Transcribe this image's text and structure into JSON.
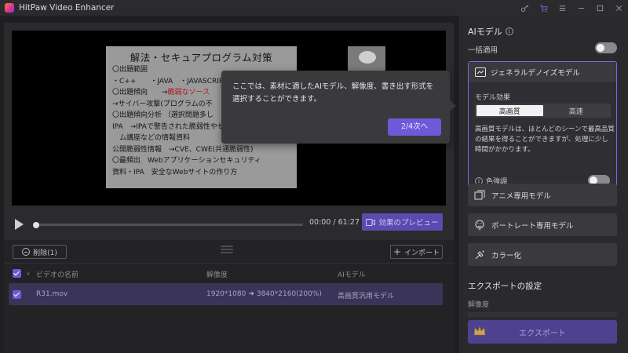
{
  "window": {
    "title": "HitPaw Video Enhancer",
    "icons": [
      "key-icon",
      "cart-icon",
      "menu-icon",
      "minimize-icon",
      "maximize-icon",
      "close-icon"
    ]
  },
  "preview": {
    "slide": {
      "title": "解法・セキュアプログラム対策",
      "lines": [
        "〇出題範囲",
        "・C++　　・JAVA　・JAVASCRIPT＆",
        "〇出題傾向　　→脆弱なソース",
        "→サイバー攻撃(プログラムの不",
        "〇出題傾向分析 （選択問題多し",
        "IPA　→IPAで警告された脆弱性やセキュアプログラ",
        "　ム講座などの情報資料",
        "公開脆弱性情報　→CVE、CWE(共通脆弱性)",
        "〇最頻出　Webアプリケーションセキュリティ",
        "資料・IPA　安全なWebサイトの作り方"
      ],
      "line2_prefix": "〇出題傾向　　→",
      "line2_red": "脆弱なソース"
    },
    "time": "00:00 / 61:27",
    "preview_button": "効果のプレビュー",
    "progress": 0
  },
  "tooltip": {
    "text": "ここでは、素材に適したAIモデル、解像度、書き出す形式を選択することができます。",
    "button": "2/4次へ"
  },
  "list": {
    "delete_button": "削除(1)",
    "import_button": "インポート",
    "headers": {
      "name": "ビデオの名前",
      "resolution": "解像度",
      "model": "AIモデル"
    },
    "rows": [
      {
        "name": "R31.mov",
        "from_res": "1920*1080",
        "to_res": "3840*2160(200%)",
        "model": "高画質汎用モデル",
        "checked": true
      }
    ]
  },
  "sidebar": {
    "ai_title": "AIモデル",
    "batch_apply": "一括適用",
    "batch_apply_on": false,
    "active_model": {
      "name": "ジェネラルデノイズモデル",
      "effect_label": "モデル効果",
      "options": [
        "高画質",
        "高速"
      ],
      "selected_option": "高画質",
      "description": "高画質モデルは、ほとんどのシーンで最高品質の結果を得ることができますが、処理に少し時間がかかります。",
      "color_enhance": "色強調",
      "color_enhance_on": false
    },
    "models": [
      {
        "name": "アニメ専用モデル",
        "icon": "anime-icon"
      },
      {
        "name": "ポートレート専用モデル",
        "icon": "portrait-icon"
      },
      {
        "name": "カラー化",
        "icon": "colorize-icon"
      }
    ],
    "export_title": "エクスポートの設定",
    "resolution_label": "解像度",
    "export_button": "エクスポート"
  },
  "colors": {
    "accent": "#6c5ad8",
    "selected_row": "#3a3458",
    "panel": "#2a2a2d"
  }
}
